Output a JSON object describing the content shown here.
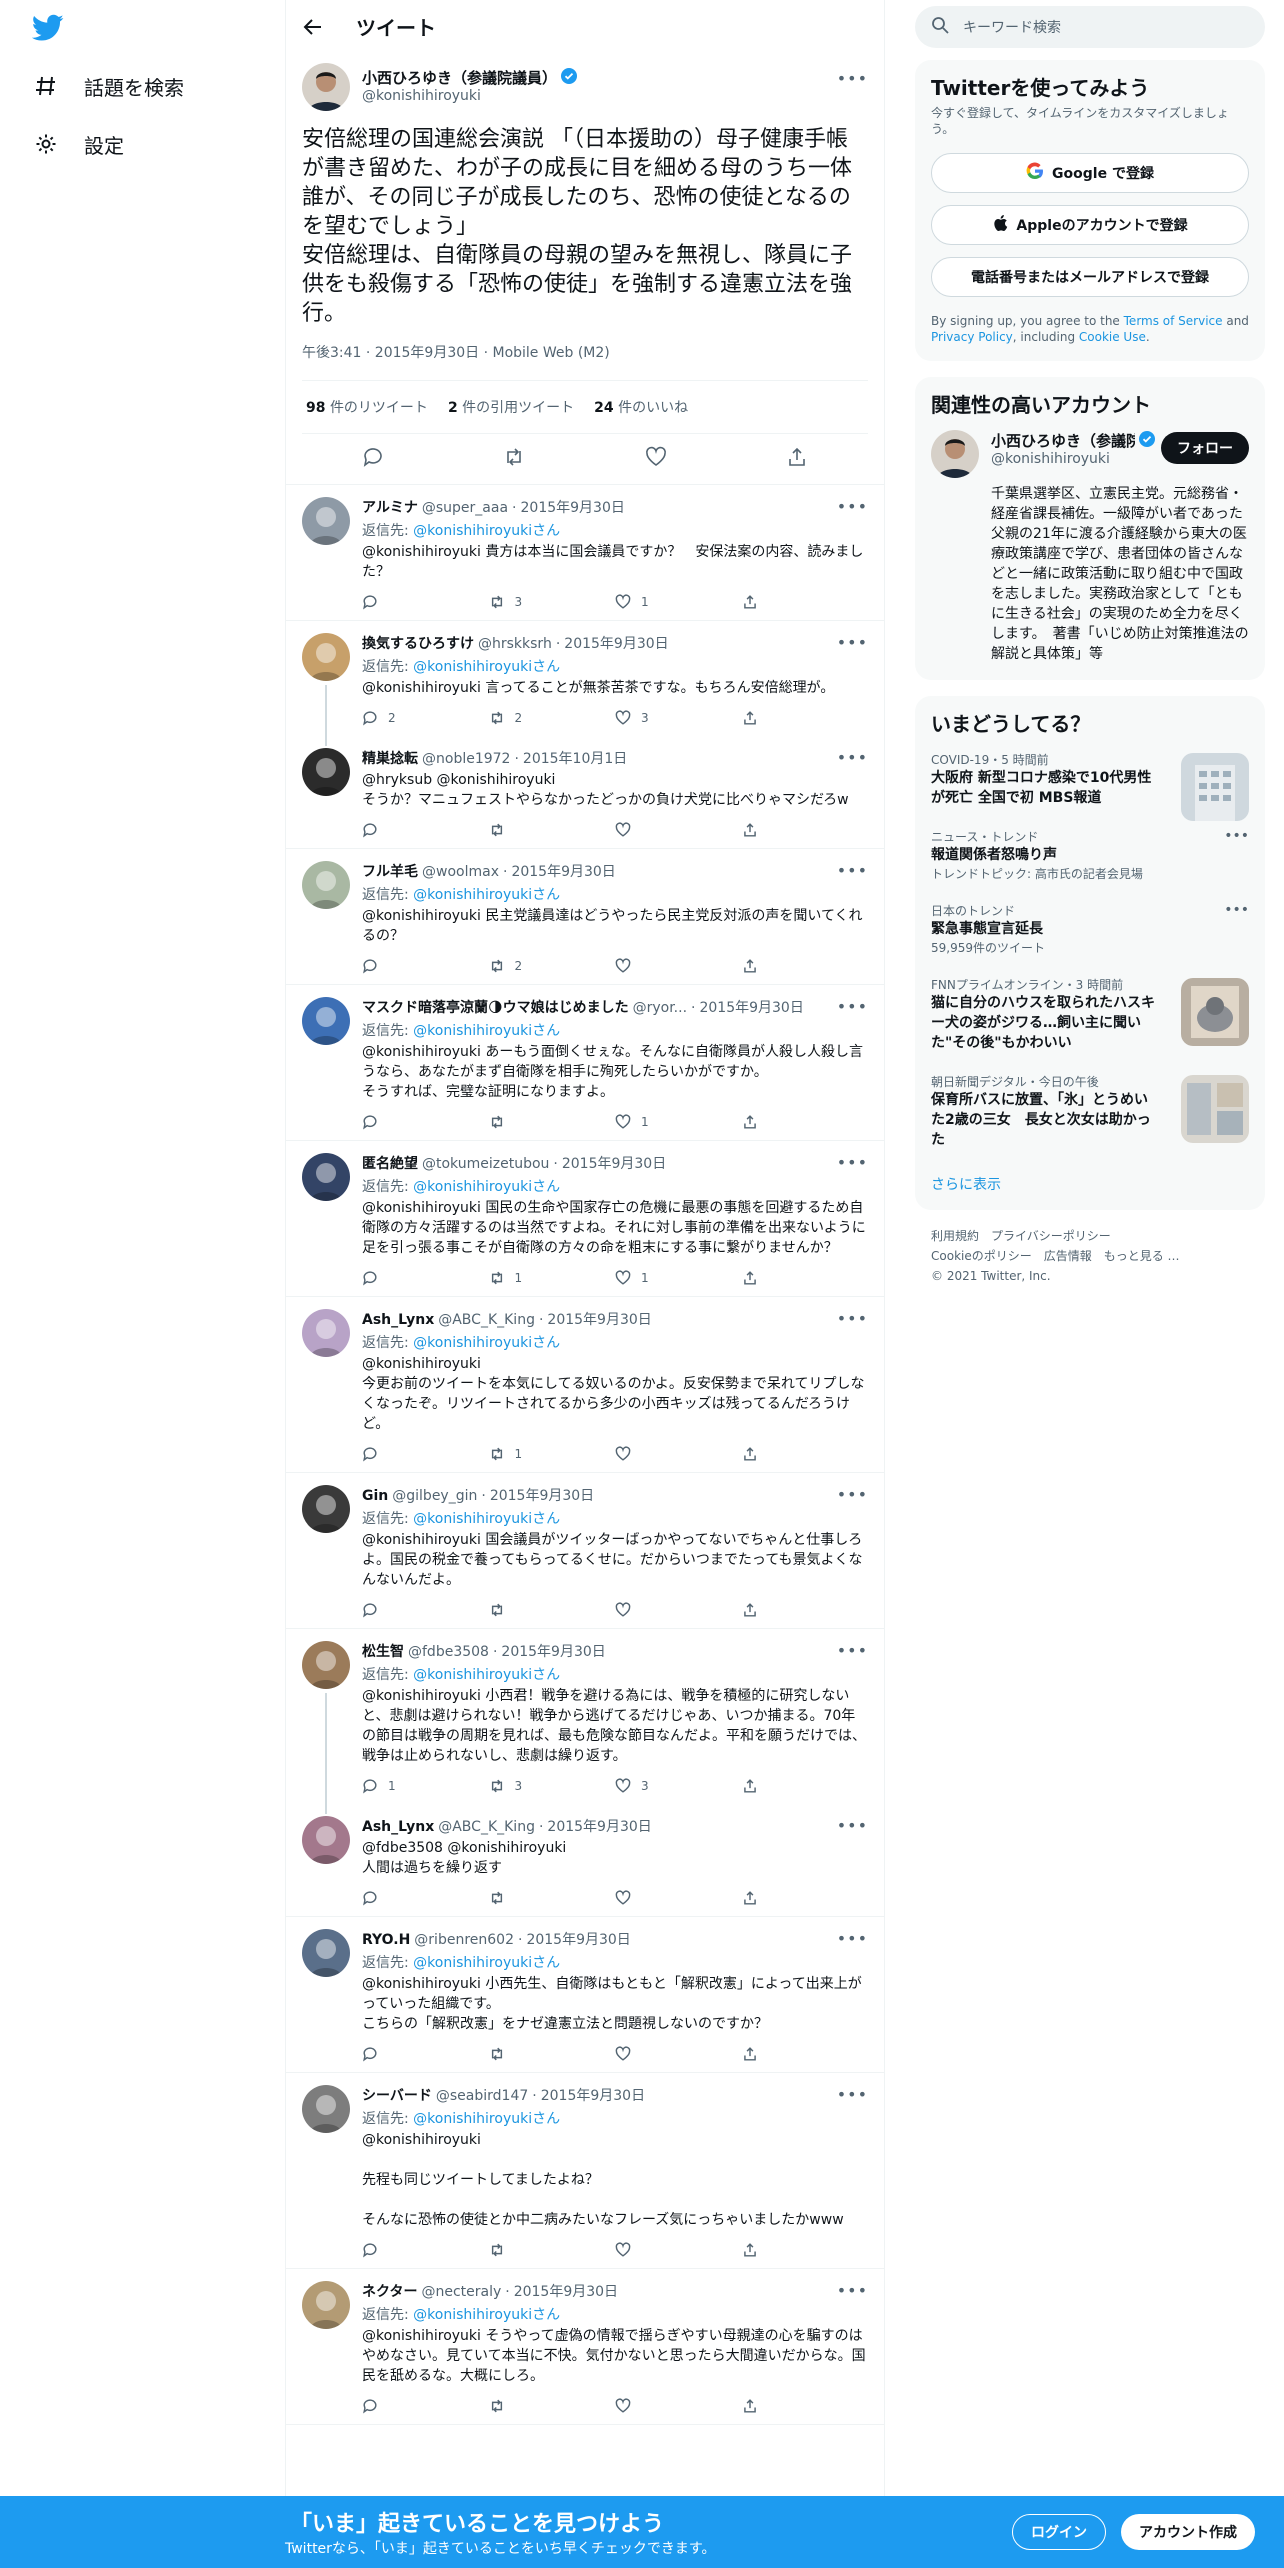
{
  "nav": {
    "explore": "話題を検索",
    "settings": "設定"
  },
  "header": {
    "title": "ツイート"
  },
  "main_tweet": {
    "name": "小西ひろゆき（参議院議員）",
    "handle": "@konishihiroyuki",
    "text": "安倍総理の国連総会演説 「（日本援助の）母子健康手帳が書き留めた、わが子の成長に目を細める母のうち一体誰が、その同じ子が成長したのち、恐怖の使徒となるのを望むでしょう」\n安倍総理は、自衛隊員の母親の望みを無視し、隊員に子供をも殺傷する「恐怖の使徒」を強制する違憲立法を強行。",
    "meta": "午後3:41 · 2015年9月30日 · Mobile Web (M2)",
    "retweets": "98",
    "retweets_label": "件のリツイート",
    "quotes": "2",
    "quotes_label": "件の引用ツイート",
    "likes": "24",
    "likes_label": "件のいいね"
  },
  "reply_prefix": "返信先:",
  "reply_suffix": "さん",
  "replies": [
    {
      "name": "アルミナ",
      "handle": "@super_aaa",
      "date": "2015年9月30日",
      "to": "@konishihiroyukiさん",
      "text": "@konishihiroyuki 貴方は本当に国会議員ですか？　安保法案の内容、読みました？",
      "reply": "",
      "rt": "3",
      "like": "1"
    },
    {
      "name": "換気するひろすけ",
      "handle": "@hrskksrh",
      "date": "2015年9月30日",
      "to": "@konishihiroyukiさん",
      "text": "@konishihiroyuki 言ってることが無茶苦茶ですな。もちろん安倍総理が。",
      "reply": "2",
      "rt": "2",
      "like": "3"
    },
    {
      "name": "精巣捻転",
      "handle": "@noble1972",
      "date": "2015年10月1日",
      "to": "",
      "text": "@hryksub @konishihiroyuki\nそうか？マニュフェストやらなかったどっかの負け犬党に比べりゃマシだろw",
      "reply": "",
      "rt": "",
      "like": ""
    },
    {
      "name": "フル羊毛",
      "handle": "@woolmax",
      "date": "2015年9月30日",
      "to": "@konishihiroyukiさん",
      "text": "@konishihiroyuki 民主党議員達はどうやったら民主党反対派の声を聞いてくれるの？",
      "reply": "",
      "rt": "2",
      "like": ""
    },
    {
      "name": "マスクド暗落亭涼蘭🌗ウマ娘はじめました",
      "handle": "@ryor...",
      "date": "2015年9月30日",
      "to": "@konishihiroyukiさん",
      "text": "@konishihiroyuki あーもう面倒くせぇな。そんなに自衛隊員が人殺し人殺し言うなら、あなたがまず自衛隊を相手に殉死したらいかがですか。\nそうすれば、完璧な証明になりますよ。",
      "reply": "",
      "rt": "",
      "like": "1"
    },
    {
      "name": "匿名絶望",
      "handle": "@tokumeizetubou",
      "date": "2015年9月30日",
      "to": "@konishihiroyukiさん",
      "text": "@konishihiroyuki 国民の生命や国家存亡の危機に最悪の事態を回避するため自衛隊の方々活躍するのは当然ですよね。それに対し事前の準備を出来ないように足を引っ張る事こそが自衛隊の方々の命を粗末にする事に繋がりませんか？",
      "reply": "",
      "rt": "1",
      "like": "1"
    },
    {
      "name": "Ash_Lynx",
      "handle": "@ABC_K_King",
      "date": "2015年9月30日",
      "to": "@konishihiroyukiさん",
      "text": "@konishihiroyuki\n今更お前のツイートを本気にしてる奴いるのかよ。反安保勢まで呆れてリプしなくなったぞ。リツイートされてるから多少の小西キッズは残ってるんだろうけど。",
      "reply": "",
      "rt": "1",
      "like": ""
    },
    {
      "name": "Gin",
      "handle": "@gilbey_gin",
      "date": "2015年9月30日",
      "to": "@konishihiroyukiさん",
      "text": "@konishihiroyuki 国会議員がツイッターばっかやってないでちゃんと仕事しろよ。国民の税金で養ってもらってるくせに。だからいつまでたっても景気よくなんないんだよ。",
      "reply": "",
      "rt": "",
      "like": ""
    },
    {
      "name": "松生智",
      "handle": "@fdbe3508",
      "date": "2015年9月30日",
      "to": "@konishihiroyukiさん",
      "text": "@konishihiroyuki 小西君！戦争を避ける為には、戦争を積極的に研究しないと、悲劇は避けられない！戦争から逃げてるだけじゃあ、いつか捕まる。70年の節目は戦争の周期を見れば、最も危険な節目なんだよ。平和を願うだけでは、戦争は止められないし、悲劇は繰り返す。",
      "reply": "1",
      "rt": "3",
      "like": "3"
    },
    {
      "name": "Ash_Lynx",
      "handle": "@ABC_K_King",
      "date": "2015年9月30日",
      "to": "",
      "text": "@fdbe3508 @konishihiroyuki\n人間は過ちを繰り返す",
      "reply": "",
      "rt": "",
      "like": ""
    },
    {
      "name": "RYO.H",
      "handle": "@ribenren602",
      "date": "2015年9月30日",
      "to": "@konishihiroyukiさん",
      "text": "@konishihiroyuki 小西先生、自衛隊はもともと「解釈改憲」によって出来上がっていった組織です。\nこちらの「解釈改憲」をナゼ違憲立法と問題視しないのですか？",
      "reply": "",
      "rt": "",
      "like": ""
    },
    {
      "name": "シーバード",
      "handle": "@seabird147",
      "date": "2015年9月30日",
      "to": "@konishihiroyukiさん",
      "text": "@konishihiroyuki\n\n先程も同じツイートしてましたよね？\n\nそんなに恐怖の使徒とか中二病みたいなフレーズ気にっちゃいましたかwww",
      "reply": "",
      "rt": "",
      "like": ""
    },
    {
      "name": "ネクター",
      "handle": "@necteraly",
      "date": "2015年9月30日",
      "to": "@konishihiroyukiさん",
      "text": "@konishihiroyuki そうやって虚偽の情報で揺らぎやすい母親達の心を騙すのはやめなさい。見ていて本当に不快。気付かないと思ったら大間違いだからな。国民を舐めるな。大概にしろ。",
      "reply": "",
      "rt": "",
      "like": ""
    }
  ],
  "right": {
    "search_placeholder": "キーワード検索",
    "signup_title": "Twitterを使ってみよう",
    "signup_sub": "今すぐ登録して、タイムラインをカスタマイズしましょう。",
    "google": "Google で登録",
    "apple": "Appleのアカウントで登録",
    "phone": "電話番号またはメールアドレスで登録",
    "legal_1": "By signing up, you agree to the ",
    "terms": "Terms of Service",
    "legal_2": " and ",
    "privacy": "Privacy Policy",
    "legal_3": ", including ",
    "cookie": "Cookie Use",
    "legal_4": ".",
    "related_title": "関連性の高いアカウント",
    "related_name": "小西ひろゆき（参議院議員）",
    "related_handle": "@konishihiroyuki",
    "follow": "フォロー",
    "related_bio": "千葉県選挙区、立憲民主党。元総務省・経産省課長補佐。一級障がい者であった父親の21年に渡る介護経験から東大の医療政策講座で学び、患者団体の皆さんなどと一緒に政策活動に取り組む中で国政を志しました。実務政治家として「ともに生きる社会」の実現のため全力を尽くします。　著書「いじめ防止対策推進法の解説と具体策」等",
    "trends_title": "いまどうしてる？",
    "trends": [
      {
        "meta": "COVID-19・5 時間前",
        "title": "大阪府 新型コロナ感染で10代男性が死亡 全国で初 MBS報道",
        "sub": ""
      },
      {
        "meta": "ニュース・トレンド",
        "title": "報道関係者怒鳴り声",
        "sub": "トレンドトピック: 高市氏の記者会見場"
      },
      {
        "meta": "日本のトレンド",
        "title": "緊急事態宣言延長",
        "sub": "59,959件のツイート"
      },
      {
        "meta": "FNNプライムオンライン・3 時間前",
        "title": "猫に自分のハウスを取られたハスキー犬の姿がジワる…飼い主に聞いた\"その後\"もかわいい",
        "sub": ""
      },
      {
        "meta": "朝日新聞デジタル・今日の午後",
        "title": "保育所バスに放置、「氷」とうめいた2歳の三女　長女と次女は助かった",
        "sub": ""
      }
    ],
    "show_more": "さらに表示",
    "footer_1": "利用規約　プライバシーポリシー",
    "footer_2": "Cookieのポリシー　広告情報　もっと見る …",
    "footer_3": "© 2021 Twitter, Inc."
  },
  "bottom": {
    "big": "「いま」起きていることを見つけよう",
    "small": "Twitterなら、「いま」起きていることをいち早くチェックできます。",
    "login": "ログイン",
    "signup": "アカウント作成"
  },
  "colors": {
    "accent": "#1d9bf0",
    "link": "#1b95e0"
  }
}
